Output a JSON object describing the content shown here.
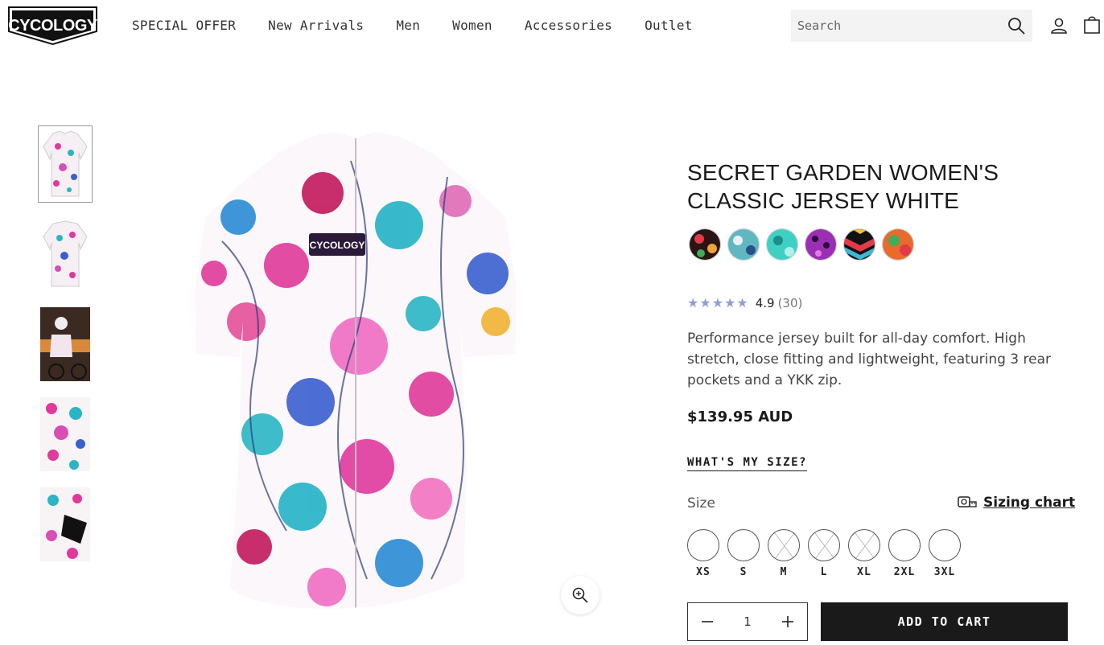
{
  "header": {
    "logo_text": "CYCOLOGY",
    "nav": [
      "SPECIAL OFFER",
      "New Arrivals",
      "Men",
      "Women",
      "Accessories",
      "Outlet"
    ],
    "search_placeholder": "Search"
  },
  "gallery": {
    "thumbnail_count": 5,
    "active_index": 0
  },
  "product": {
    "title": "SECRET GARDEN WOMEN'S CLASSIC JERSEY WHITE",
    "swatch_colors": [
      "#3a1a1a",
      "#5fb7bf",
      "#3ed0c4",
      "#9b2fb4",
      "#e23a4a",
      "#e86a2c"
    ],
    "rating": {
      "stars_icon": "star-icon",
      "value": 4.9,
      "score_text": "4.9",
      "count_text": "(30)"
    },
    "description": "Performance jersey built for all-day comfort. High stretch, close fitting and lightweight, featuring 3 rear pockets and a YKK zip.",
    "price": "$139.95 AUD",
    "whats_my_size": "WHAT'S MY SIZE?",
    "size_label": "Size",
    "sizing_chart": "Sizing chart",
    "sizes": [
      {
        "label": "XS",
        "available": true
      },
      {
        "label": "S",
        "available": true
      },
      {
        "label": "M",
        "available": false
      },
      {
        "label": "L",
        "available": false
      },
      {
        "label": "XL",
        "available": false
      },
      {
        "label": "2XL",
        "available": true
      },
      {
        "label": "3XL",
        "available": true
      }
    ],
    "quantity": "1",
    "add_to_cart": "ADD TO CART"
  },
  "colors": {
    "text": "#1a1a1a",
    "star": "#8f9fd6",
    "button_bg": "#1a1a1a"
  }
}
